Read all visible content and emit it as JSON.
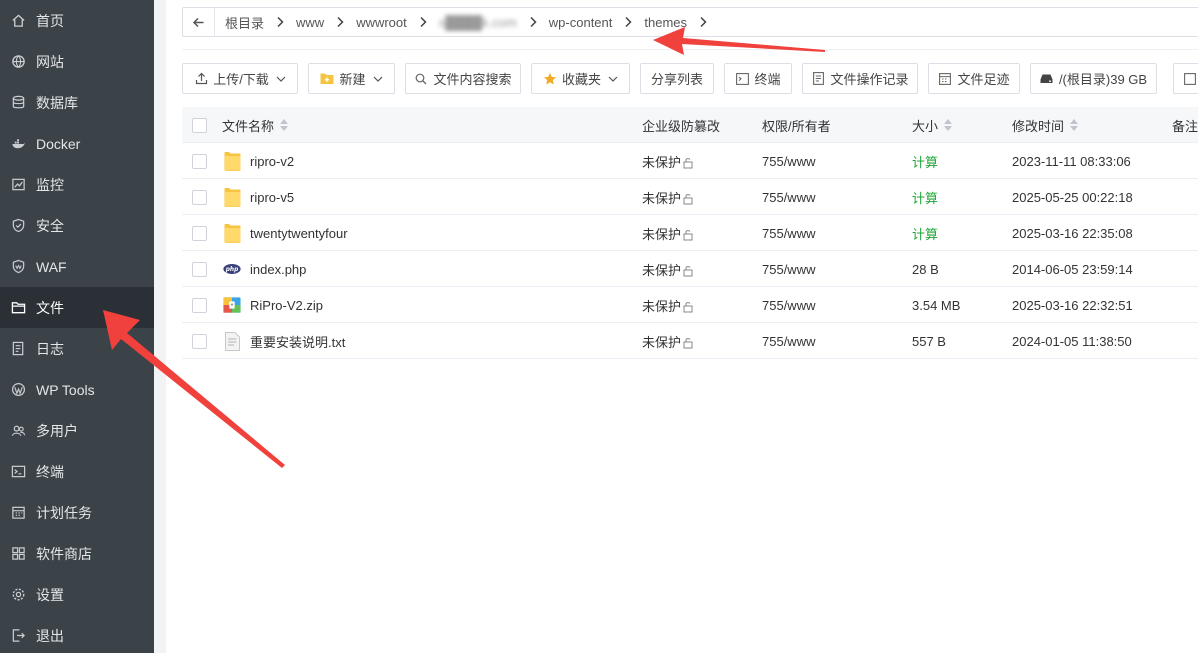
{
  "sidebar": {
    "items": [
      {
        "label": "首页",
        "icon": "home-icon"
      },
      {
        "label": "网站",
        "icon": "globe-icon"
      },
      {
        "label": "数据库",
        "icon": "database-icon"
      },
      {
        "label": "Docker",
        "icon": "docker-icon"
      },
      {
        "label": "监控",
        "icon": "chart-icon"
      },
      {
        "label": "安全",
        "icon": "shield-icon"
      },
      {
        "label": "WAF",
        "icon": "waf-shield-icon"
      },
      {
        "label": "文件",
        "icon": "folder-icon",
        "active": true
      },
      {
        "label": "日志",
        "icon": "log-icon"
      },
      {
        "label": "WP Tools",
        "icon": "wordpress-icon"
      },
      {
        "label": "多用户",
        "icon": "users-icon"
      },
      {
        "label": "终端",
        "icon": "terminal-icon"
      },
      {
        "label": "计划任务",
        "icon": "calendar-icon"
      },
      {
        "label": "软件商店",
        "icon": "apps-icon"
      },
      {
        "label": "设置",
        "icon": "gear-icon"
      },
      {
        "label": "退出",
        "icon": "logout-icon"
      }
    ]
  },
  "path": {
    "crumbs": [
      "根目录",
      "www",
      "wwwroot",
      "s████k.com",
      "wp-content",
      "themes"
    ]
  },
  "toolbar": {
    "upload": "上传/下载",
    "new": "新建",
    "search": "文件内容搜索",
    "favorites": "收藏夹",
    "share": "分享列表",
    "terminal": "终端",
    "oplog": "文件操作记录",
    "footprint": "文件足迹",
    "disk": "/(根目录)39 GB"
  },
  "table": {
    "headers": {
      "name": "文件名称",
      "protect": "企业级防篡改",
      "perm": "权限/所有者",
      "size": "大小",
      "mtime": "修改时间",
      "note": "备注"
    },
    "rows": [
      {
        "name": "ripro-v2",
        "type": "folder",
        "protect": "未保护",
        "perm": "755/www",
        "size": "计算",
        "size_is_link": true,
        "mtime": "2023-11-11 08:33:06"
      },
      {
        "name": "ripro-v5",
        "type": "folder",
        "protect": "未保护",
        "perm": "755/www",
        "size": "计算",
        "size_is_link": true,
        "mtime": "2025-05-25 00:22:18"
      },
      {
        "name": "twentytwentyfour",
        "type": "folder",
        "protect": "未保护",
        "perm": "755/www",
        "size": "计算",
        "size_is_link": true,
        "mtime": "2025-03-16 22:35:08"
      },
      {
        "name": "index.php",
        "type": "php",
        "protect": "未保护",
        "perm": "755/www",
        "size": "28 B",
        "size_is_link": false,
        "mtime": "2014-06-05 23:59:14"
      },
      {
        "name": "RiPro-V2.zip",
        "type": "zip",
        "protect": "未保护",
        "perm": "755/www",
        "size": "3.54 MB",
        "size_is_link": false,
        "mtime": "2025-03-16 22:32:51"
      },
      {
        "name": "重要安装说明.txt",
        "type": "txt",
        "protect": "未保护",
        "perm": "755/www",
        "size": "557 B",
        "size_is_link": false,
        "mtime": "2024-01-05 11:38:50"
      }
    ]
  },
  "colors": {
    "sidebar_bg": "#3b4349",
    "sidebar_active": "#2a3035",
    "accent_green": "#20a53a",
    "annotation_arrow": "#f0413c"
  }
}
